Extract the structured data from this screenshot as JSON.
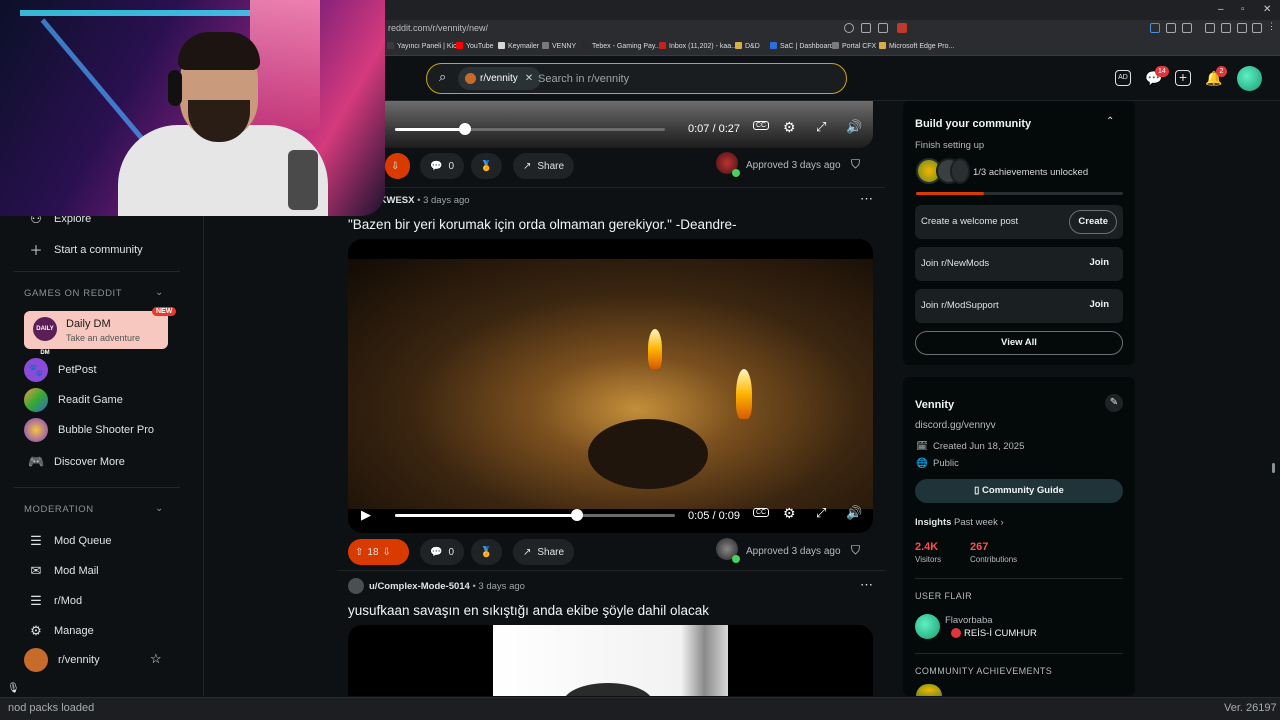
{
  "browser": {
    "url": "reddit.com/r/vennity/new/",
    "bookmarks": [
      "Yayıncı Paneli | Kick",
      "YouTube",
      "Keymailer",
      "VENNY",
      "Tebex - Gaming Pay...",
      "Inbox (11,202) - kaa...",
      "D&D",
      "SaC | Dashboard",
      "Portal CFX",
      "Microsoft Edge Pro..."
    ],
    "bookmark_colors": [
      "#3a3a3a",
      "#ff0000",
      "#d6d6d6",
      "#7a7a7a",
      "#2a2a2a",
      "#c5221f",
      "#d8b04a",
      "#2a6fdb",
      "#7a7a7a",
      "#d8b04a"
    ]
  },
  "header": {
    "community_chip": "r/vennity",
    "search_placeholder": "Search in r/vennity",
    "chat_badge": "14",
    "notif_badge": "2"
  },
  "sidebar": {
    "top_items": [
      {
        "label": "Explore",
        "icon": "explore-icon"
      },
      {
        "label": "Start a community",
        "icon": "plus-icon"
      }
    ],
    "games_heading": "GAMES ON REDDIT",
    "daily_dm": {
      "title": "Daily DM",
      "subtitle": "Take an adventure",
      "badge": "NEW",
      "icon_text": "DAILY DM"
    },
    "games": [
      {
        "label": "PetPost",
        "color": "#8a4bd8"
      },
      {
        "label": "Readit Game",
        "color": "#2f3b2f"
      },
      {
        "label": "Bubble Shooter Pro",
        "color": "#7b3bd0"
      },
      {
        "label": "Discover More",
        "color": ""
      }
    ],
    "moderation_heading": "MODERATION",
    "mod_items": [
      "Mod Queue",
      "Mod Mail",
      "r/Mod",
      "Manage",
      "r/vennity"
    ]
  },
  "post0": {
    "time": "0:07 / 0:27",
    "progress": 0.26,
    "comments": "0",
    "share": "Share",
    "approved": "Approved 3 days ago"
  },
  "post1": {
    "author": "/KWESX",
    "age": "• 3 days ago",
    "title": "\"Bazen bir yeri korumak için orda olmaman gerekiyor.\" -Deandre-",
    "time": "0:05 / 0:09",
    "progress": 0.65,
    "votes": "18",
    "comments": "0",
    "share": "Share",
    "approved": "Approved 3 days ago"
  },
  "post2": {
    "author": "u/Complex-Mode-5014",
    "age": "• 3 days ago",
    "title": "yusufkaan savaşın en sıkıştığı anda ekibe şöyle dahil olacak"
  },
  "right": {
    "build_title": "Build your community",
    "finish": "Finish setting up",
    "achievements": "1/3 achievements unlocked",
    "achievement_progress": 0.33,
    "rows": [
      {
        "label": "Create a welcome post",
        "btn": "Create"
      },
      {
        "label": "Join r/NewMods",
        "btn": "Join"
      },
      {
        "label": "Join r/ModSupport",
        "btn": "Join"
      }
    ],
    "view_all": "View All",
    "community_name": "Vennity",
    "community_link": "discord.gg/vennyv",
    "created": "Created Jun 18, 2025",
    "visibility": "Public",
    "guide": "Community Guide",
    "insights": "Insights",
    "insights_range": "Past week",
    "visitors_val": "2.4K",
    "visitors_lbl": "Visitors",
    "contrib_val": "267",
    "contrib_lbl": "Contributions",
    "user_flair_heading": "USER FLAIR",
    "flair_user": "Flavorbaba",
    "flair_text": "REİS-İ CUMHUR",
    "achievements_heading": "COMMUNITY ACHIEVEMENTS"
  },
  "status": {
    "left": "nod packs loaded",
    "right": "Ver. 26197"
  },
  "colors": {
    "accent_orange": "#d93a00",
    "stat_red": "#ff4d4d",
    "online_green": "#46d160"
  }
}
